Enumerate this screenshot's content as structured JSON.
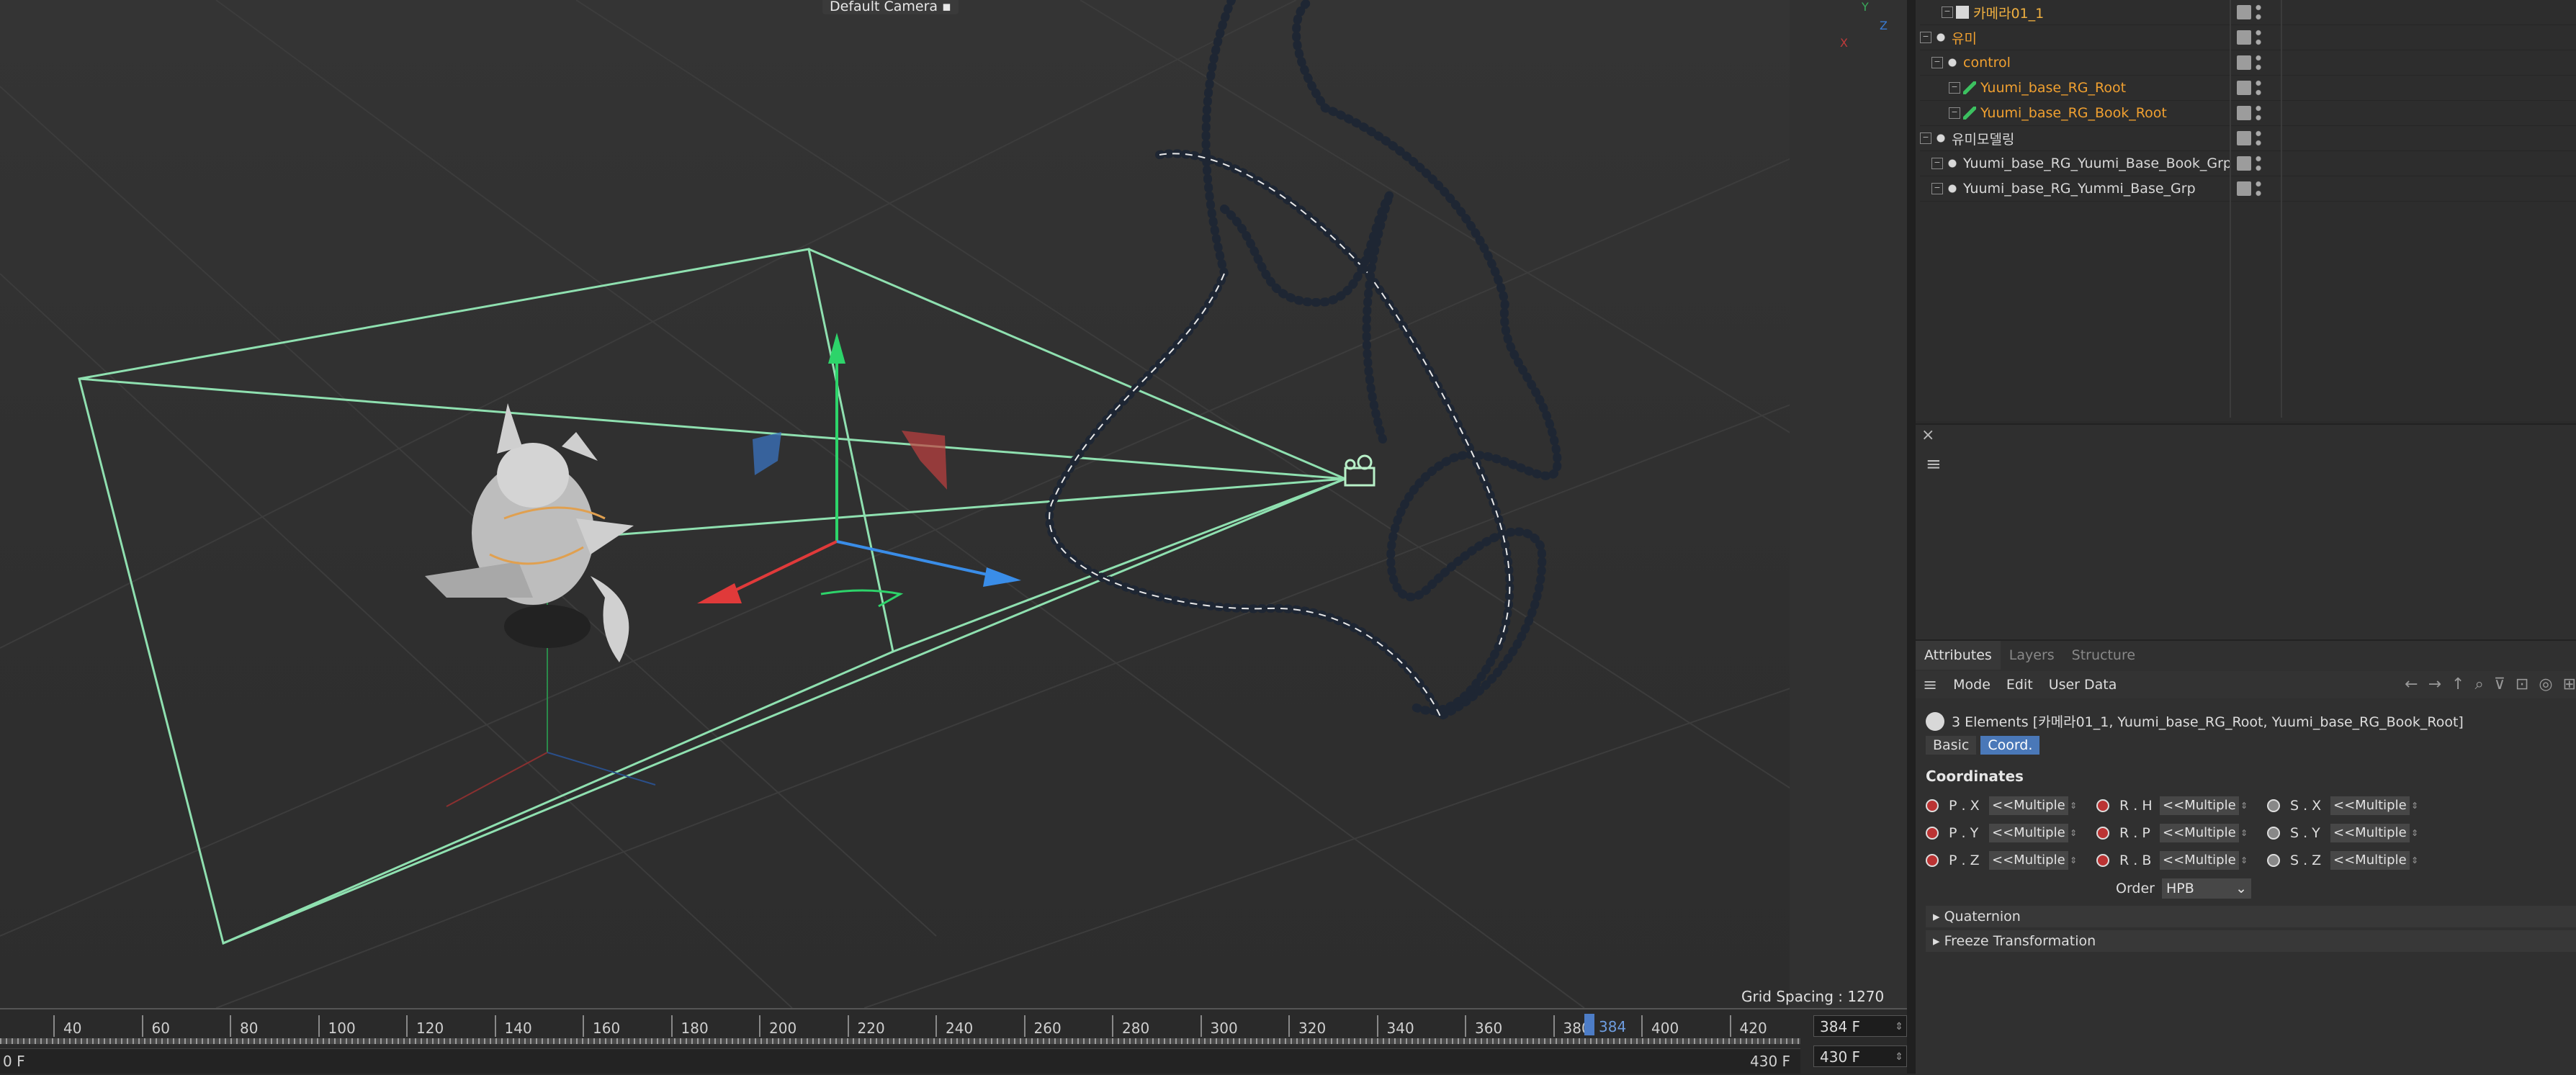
{
  "viewport": {
    "camera_label": "Default Camera",
    "grid_spacing": "Grid Spacing : 1270 cm",
    "axis_labels": {
      "x": "X",
      "y": "Y",
      "z": "Z"
    }
  },
  "timeline": {
    "ticks": [
      "40",
      "60",
      "80",
      "100",
      "120",
      "140",
      "160",
      "180",
      "200",
      "220",
      "240",
      "260",
      "280",
      "300",
      "320",
      "340",
      "360",
      "380",
      "400",
      "420"
    ],
    "current_frame_label": "384",
    "range_start": "0 F",
    "range_end": "430 F",
    "current_frame_field": "384 F",
    "end_frame_field": "430 F"
  },
  "object_manager": {
    "rows": [
      {
        "name": "카메라01_1",
        "color": "#f0b040",
        "icon": "camera-icon"
      },
      {
        "name": "유미",
        "color": "#f0a030",
        "icon": "null-icon"
      },
      {
        "name": "control",
        "color": "#f0a030",
        "icon": "null-icon"
      },
      {
        "name": "Yuumi_base_RG_Root",
        "color": "#f0a030",
        "icon": "joint-icon"
      },
      {
        "name": "Yuumi_base_RG_Book_Root",
        "color": "#f0a030",
        "icon": "joint-icon"
      },
      {
        "name": "유미모델링",
        "color": "#d8d8d8",
        "icon": "null-icon"
      },
      {
        "name": "Yuumi_base_RG_Yuumi_Base_Book_Grp",
        "color": "#d8d8d8",
        "icon": "null-icon"
      },
      {
        "name": "Yuumi_base_RG_Yummi_Base_Grp",
        "color": "#d8d8d8",
        "icon": "null-icon"
      }
    ]
  },
  "attributes": {
    "tabs": [
      "Attributes",
      "Layers",
      "Structure"
    ],
    "menu": [
      "Mode",
      "Edit",
      "User Data"
    ],
    "selection": "3 Elements [카메라01_1, Yuumi_base_RG_Root, Yuumi_base_RG_Book_Root]",
    "buttons": [
      "Basic",
      "Coord."
    ],
    "section": "Coordinates",
    "rows": [
      [
        {
          "label": "P . X",
          "value": "<<Multiple"
        },
        {
          "label": "R . H",
          "value": "<<Multiple"
        },
        {
          "label": "S . X",
          "value": "<<Multiple"
        }
      ],
      [
        {
          "label": "P . Y",
          "value": "<<Multiple"
        },
        {
          "label": "R . P",
          "value": "<<Multiple"
        },
        {
          "label": "S . Y",
          "value": "<<Multiple"
        }
      ],
      [
        {
          "label": "P . Z",
          "value": "<<Multiple"
        },
        {
          "label": "R . B",
          "value": "<<Multiple"
        },
        {
          "label": "S . Z",
          "value": "<<Multiple"
        }
      ]
    ],
    "order_label": "Order",
    "order_value": "HPB",
    "collapsibles": [
      "Quaternion",
      "Freeze Transformation"
    ]
  },
  "colors": {
    "accent": "#4a78b8",
    "frustum": "#8fe0b0",
    "path": "#1e2633"
  }
}
